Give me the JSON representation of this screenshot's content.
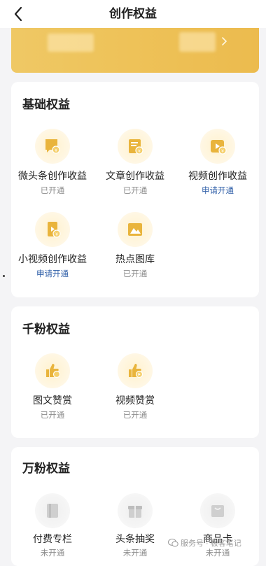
{
  "header": {
    "title": "创作权益"
  },
  "colors": {
    "accent_gold": "#eec35a",
    "status_link": "#2f5fa8",
    "status_muted": "#8c8c8c"
  },
  "sections": [
    {
      "title": "基础权益",
      "items": [
        {
          "label": "微头条创作收益",
          "status": "已开通",
          "icon": "microheadline-icon"
        },
        {
          "label": "文章创作收益",
          "status": "已开通",
          "icon": "article-icon"
        },
        {
          "label": "视频创作收益",
          "status": "申请开通",
          "icon": "video-icon"
        },
        {
          "label": "小视频创作收益",
          "status": "申请开通",
          "icon": "short-video-icon"
        },
        {
          "label": "热点图库",
          "status": "已开通",
          "icon": "image-library-icon"
        }
      ]
    },
    {
      "title": "千粉权益",
      "items": [
        {
          "label": "图文赞赏",
          "status": "已开通",
          "icon": "thumbs-up-icon"
        },
        {
          "label": "视频赞赏",
          "status": "已开通",
          "icon": "video-thumbs-up-icon"
        }
      ]
    },
    {
      "title": "万粉权益",
      "items": [
        {
          "label": "付费专栏",
          "status": "未开通",
          "icon": "paid-column-icon"
        },
        {
          "label": "头条抽奖",
          "status": "未开通",
          "icon": "lottery-icon"
        },
        {
          "label": "商品卡",
          "status": "未开通",
          "icon": "product-card-icon"
        }
      ]
    }
  ],
  "watermark": {
    "text": "服务号 · 极客笔记"
  }
}
